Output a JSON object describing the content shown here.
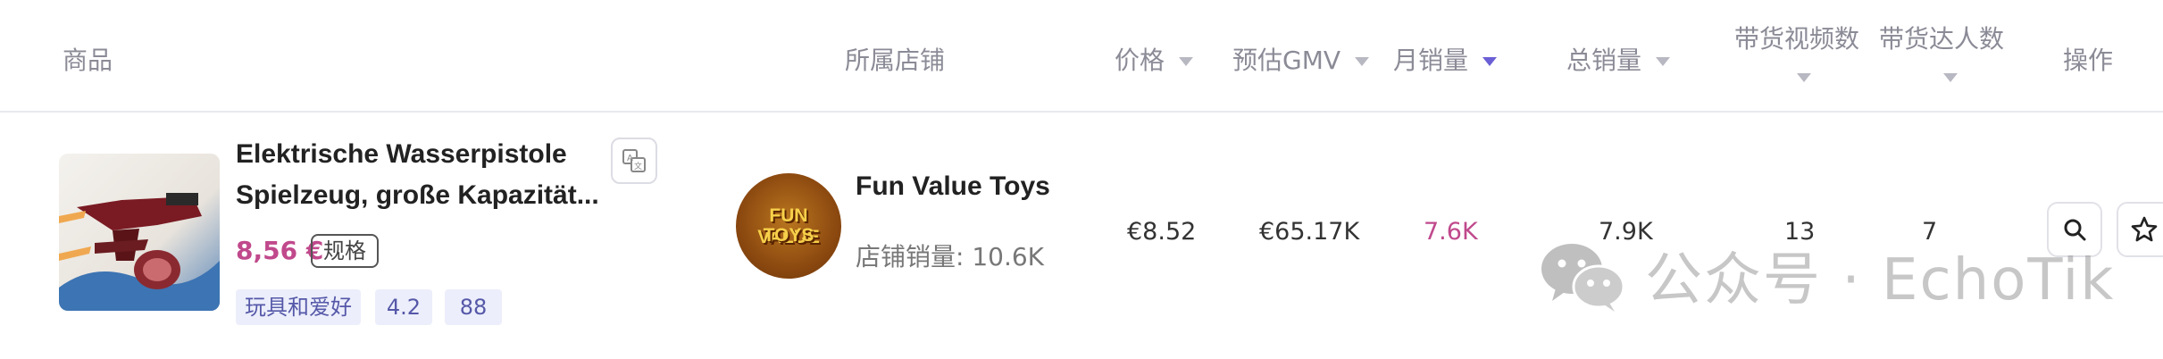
{
  "header": {
    "columns": {
      "product": "商品",
      "shop": "所属店铺",
      "price": "价格",
      "gmv": "预估GMV",
      "monthly_sales": "月销量",
      "total_sales": "总销量",
      "video_count": "带货视频数",
      "creator_count": "带货达人数",
      "actions": "操作"
    },
    "sorted_column": "monthly_sales",
    "colors": {
      "sort_active": "#6b5fd6",
      "sort_inactive": "#b8b8c2"
    }
  },
  "row": {
    "product": {
      "title_line1": "Elektrische Wasserpistole",
      "title_line2": "Spielzeug, große Kapazität...",
      "price": "8,56 €",
      "spec_label": "规格",
      "tags": [
        "玩具和爱好",
        "4.2",
        "88"
      ],
      "image_icon": "water-gun-product-image",
      "translate_icon": "translate-icon"
    },
    "shop": {
      "logo_line1": "FUN VALUE",
      "logo_line2": "TOYS",
      "name": "Fun Value Toys",
      "sales_text": "店铺销量: 10.6K"
    },
    "price": "€8.52",
    "gmv": "€65.17K",
    "monthly_sales": "7.6K",
    "total_sales": "7.9K",
    "video_count": "13",
    "creator_count": "7",
    "actions": {
      "search_icon": "search-icon",
      "favorite_icon": "star-icon"
    },
    "colors": {
      "highlight": "#c0498c"
    }
  },
  "watermark": {
    "text": "公众号 · EchoTik",
    "icon": "wechat-icon"
  }
}
